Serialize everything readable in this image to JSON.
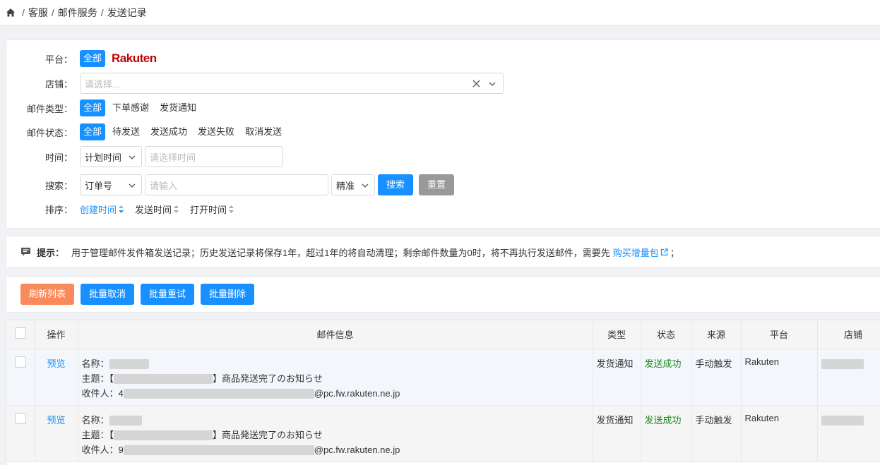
{
  "breadcrumb": {
    "items": [
      "客服",
      "邮件服务",
      "发送记录"
    ],
    "separator": "/"
  },
  "filters": {
    "platform": {
      "label": "平台：",
      "options": [
        "全部"
      ],
      "logo_text": "Rakuten"
    },
    "store": {
      "label": "店铺：",
      "placeholder": "请选择..."
    },
    "mail_type": {
      "label": "邮件类型：",
      "options": [
        "全部",
        "下单感谢",
        "发货通知"
      ]
    },
    "mail_status": {
      "label": "邮件状态：",
      "options": [
        "全部",
        "待发送",
        "发送成功",
        "发送失败",
        "取消发送"
      ]
    },
    "time": {
      "label": "时间：",
      "type_value": "计划时间",
      "placeholder": "请选择时间"
    },
    "search": {
      "label": "搜索：",
      "field_value": "订单号",
      "placeholder": "请输入",
      "mode_value": "精准",
      "search_button": "搜索",
      "reset_button": "重置"
    },
    "sort": {
      "label": "排序：",
      "items": [
        "创建时间",
        "发送时间",
        "打开时间"
      ]
    }
  },
  "tip": {
    "title": "提示：",
    "text": "用于管理邮件发件箱发送记录；历史发送记录将保存1年，超过1年的将自动清理；剩余邮件数量为0时，将不再执行发送邮件，需要先",
    "link": "购买增量包",
    "suffix": "；"
  },
  "actions": {
    "refresh": "刷新列表",
    "batch_cancel": "批量取消",
    "batch_retry": "批量重试",
    "batch_delete": "批量删除"
  },
  "table": {
    "headers": [
      "操作",
      "邮件信息",
      "类型",
      "状态",
      "来源",
      "平台",
      "店铺"
    ],
    "rows": [
      {
        "action": "预览",
        "name_label": "名称：",
        "subject_label": "主题：",
        "subject_prefix": "【",
        "subject_suffix": "】商品発送完了のお知らせ",
        "recipient_label": "收件人：",
        "recipient_prefix": "4",
        "recipient_suffix": "@pc.fw.rakuten.ne.jp",
        "type": "发货通知",
        "status": "发送成功",
        "source": "手动触发",
        "platform": "Rakuten"
      },
      {
        "action": "预览",
        "name_label": "名称：",
        "subject_label": "主题：",
        "subject_prefix": "【",
        "subject_suffix": "】商品発送完了のお知らせ",
        "recipient_label": "收件人：",
        "recipient_prefix": "9",
        "recipient_suffix": "@pc.fw.rakuten.ne.jp",
        "type": "发货通知",
        "status": "发送成功",
        "source": "手动触发",
        "platform": "Rakuten"
      }
    ]
  },
  "colors": {
    "primary": "#1890ff",
    "success": "#1a8a1a",
    "refresh": "#fa8a5c",
    "reset": "#999999",
    "brand": "#bf0000"
  }
}
